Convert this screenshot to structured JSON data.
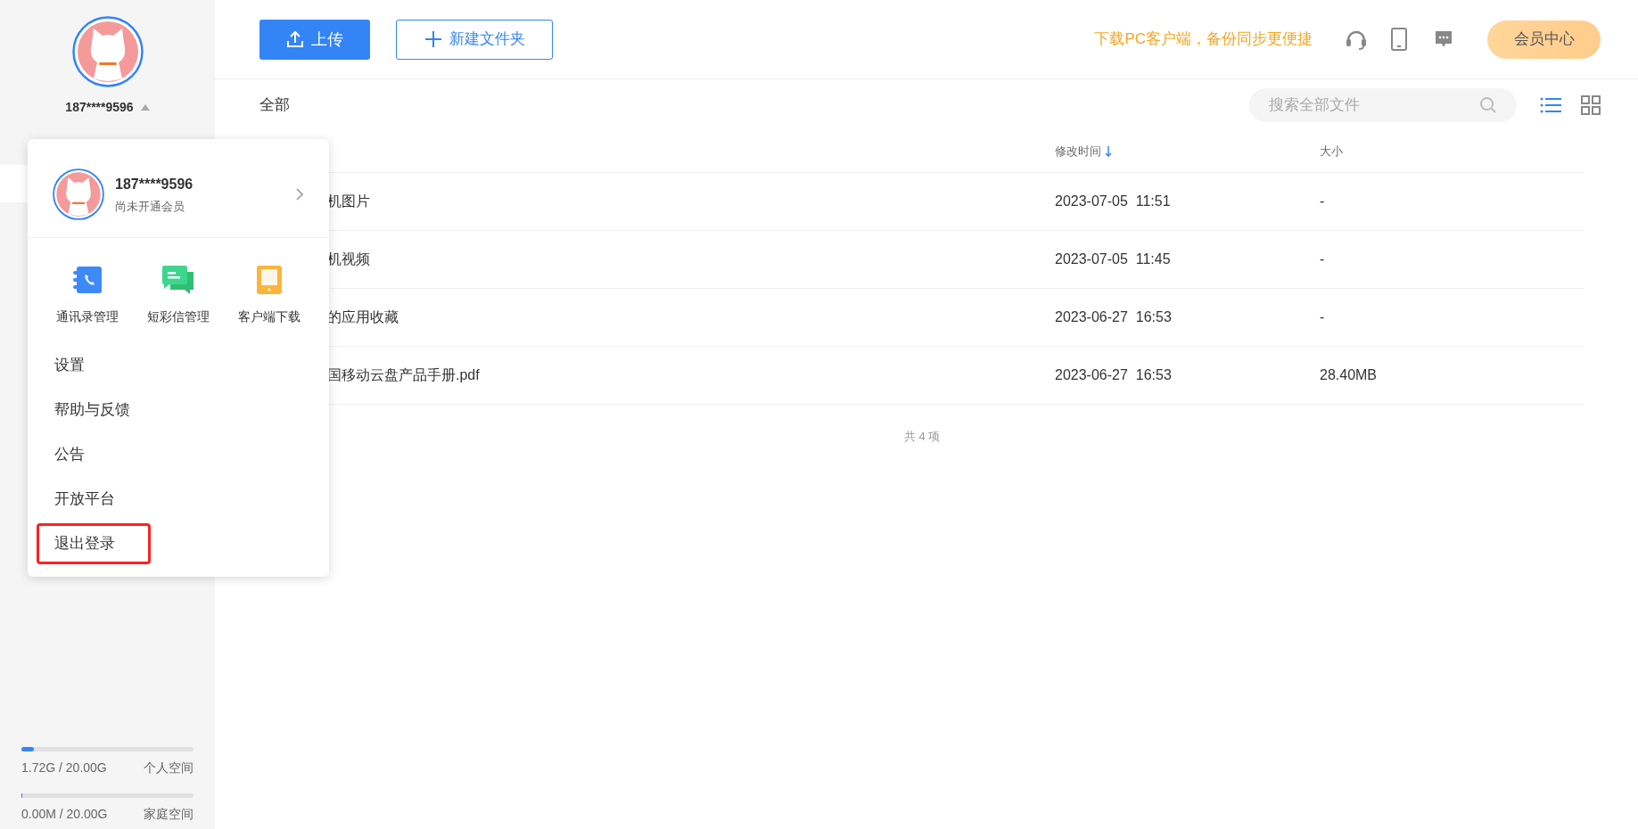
{
  "sidebar": {
    "user": {
      "name": "187****9596",
      "expanded": true
    },
    "storage": [
      {
        "usage": "1.72G / 20.00G",
        "label": "个人空间",
        "level": 0.07
      },
      {
        "usage": "0.00M / 20.00G",
        "label": "家庭空间",
        "level": 0.006
      }
    ]
  },
  "toolbar": {
    "upload": "上传",
    "new_folder": "新建文件夹",
    "promo": "下载PC客户端，备份同步更便捷",
    "member_button": "会员中心"
  },
  "breadcrumb": "全部",
  "search": {
    "placeholder": "搜索全部文件"
  },
  "view_modes": [
    {
      "kind": "list",
      "selected": true
    },
    {
      "kind": "grid",
      "selected": false
    }
  ],
  "table": {
    "columns": [
      {
        "label": "修改时间",
        "sort_descending": true
      },
      {
        "label": "大小",
        "sort_descending": false
      }
    ],
    "rows": [
      {
        "name": "机图片",
        "modified": "2023-07-05  11:51",
        "size": "-"
      },
      {
        "name": "机视频",
        "modified": "2023-07-05  11:45",
        "size": "-"
      },
      {
        "name": "的应用收藏",
        "modified": "2023-06-27  16:53",
        "size": "-"
      },
      {
        "name": "国移动云盘产品手册.pdf",
        "modified": "2023-06-27  16:53",
        "size": "28.40MB"
      }
    ],
    "footer": "共 4 项"
  },
  "user_menu": {
    "name": "187****9596",
    "subtitle": "尚未开通会员",
    "shortcuts": [
      {
        "kind": "contacts",
        "label": "通讯录管理"
      },
      {
        "kind": "messages",
        "label": "短彩信管理"
      },
      {
        "kind": "client",
        "label": "客户端下载"
      }
    ],
    "items": [
      {
        "label": "设置",
        "highlighted": false
      },
      {
        "label": "帮助与反馈",
        "highlighted": false
      },
      {
        "label": "公告",
        "highlighted": false
      },
      {
        "label": "开放平台",
        "highlighted": false
      },
      {
        "label": "退出登录",
        "highlighted": true
      }
    ]
  }
}
